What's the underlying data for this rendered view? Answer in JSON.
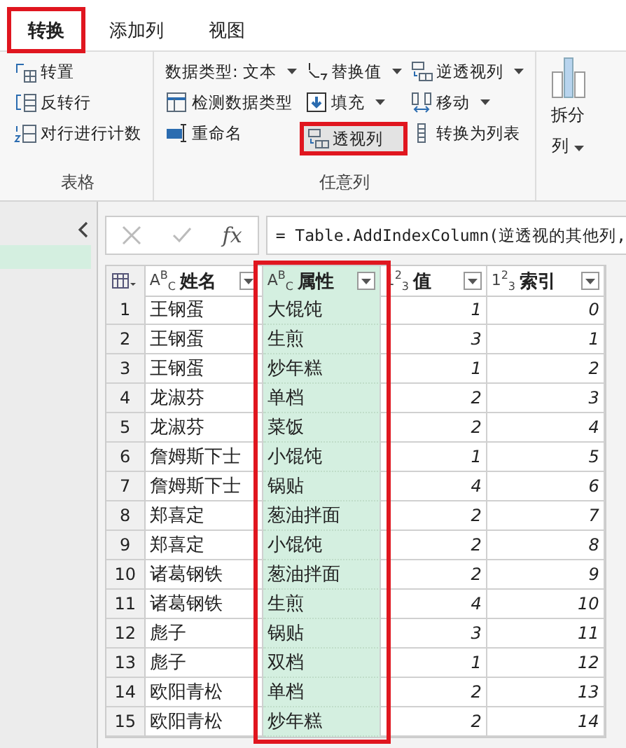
{
  "tabs": [
    {
      "label": "转换",
      "selected": true,
      "highlighted": true
    },
    {
      "label": "添加列",
      "selected": false,
      "highlighted": false
    },
    {
      "label": "视图",
      "selected": false,
      "highlighted": false
    }
  ],
  "ribbon": {
    "groups": [
      {
        "label": "表格",
        "columns": [
          [
            {
              "label": "转置",
              "kind": "transpose",
              "dropdown": false,
              "highlighted": false
            },
            {
              "label": "反转行",
              "kind": "reverse",
              "dropdown": false,
              "highlighted": false
            },
            {
              "label": "对行进行计数",
              "kind": "count",
              "dropdown": false,
              "highlighted": false
            }
          ]
        ]
      },
      {
        "label": "任意列",
        "columns": [
          [
            {
              "label": "数据类型: 文本",
              "kind": "type",
              "dropdown": true,
              "highlighted": false
            },
            {
              "label": "检测数据类型",
              "kind": "detect",
              "dropdown": false,
              "highlighted": false
            },
            {
              "label": "重命名",
              "kind": "rename",
              "dropdown": false,
              "highlighted": false
            }
          ],
          [
            {
              "label": "替换值",
              "kind": "replace",
              "dropdown": true,
              "highlighted": false
            },
            {
              "label": "填充",
              "kind": "fill",
              "dropdown": true,
              "highlighted": false
            },
            {
              "label": "透视列",
              "kind": "pivot",
              "dropdown": false,
              "highlighted": true
            }
          ],
          [
            {
              "label": "逆透视列",
              "kind": "unpivot",
              "dropdown": true,
              "highlighted": false
            },
            {
              "label": "移动",
              "kind": "move",
              "dropdown": true,
              "highlighted": false
            },
            {
              "label": "转换为列表",
              "kind": "list",
              "dropdown": false,
              "highlighted": false
            }
          ]
        ]
      }
    ],
    "big_button": {
      "label_1": "拆分",
      "label_2": "列",
      "dropdown": true
    }
  },
  "formula_bar": {
    "fx": "fx",
    "formula": "= Table.AddIndexColumn(逆透视的其他列,"
  },
  "table": {
    "columns": [
      {
        "name": "姓名",
        "type": "A$^{B}$$_{C}$",
        "kind": "text",
        "selected": false,
        "highlighted": false
      },
      {
        "name": "属性",
        "type": "A$^{B}$$_{C}$",
        "kind": "text",
        "selected": true,
        "highlighted": true
      },
      {
        "name": "值",
        "type": "1$^{2}$$_{3}$",
        "kind": "number",
        "selected": false,
        "highlighted": false
      },
      {
        "name": "索引",
        "type": "1$^{2}$$_{3}$",
        "kind": "number",
        "selected": false,
        "highlighted": false
      }
    ],
    "rows": [
      {
        "n": "1",
        "cells": [
          "王钢蛋",
          "大馄饨",
          "1",
          "0"
        ]
      },
      {
        "n": "2",
        "cells": [
          "王钢蛋",
          "生煎",
          "3",
          "1"
        ]
      },
      {
        "n": "3",
        "cells": [
          "王钢蛋",
          "炒年糕",
          "1",
          "2"
        ]
      },
      {
        "n": "4",
        "cells": [
          "龙淑芬",
          "单档",
          "2",
          "3"
        ]
      },
      {
        "n": "5",
        "cells": [
          "龙淑芬",
          "菜饭",
          "2",
          "4"
        ]
      },
      {
        "n": "6",
        "cells": [
          "詹姆斯下士",
          "小馄饨",
          "1",
          "5"
        ]
      },
      {
        "n": "7",
        "cells": [
          "詹姆斯下士",
          "锅贴",
          "4",
          "6"
        ]
      },
      {
        "n": "8",
        "cells": [
          "郑喜定",
          "葱油拌面",
          "2",
          "7"
        ]
      },
      {
        "n": "9",
        "cells": [
          "郑喜定",
          "小馄饨",
          "2",
          "8"
        ]
      },
      {
        "n": "10",
        "cells": [
          "诸葛钢铁",
          "葱油拌面",
          "2",
          "9"
        ]
      },
      {
        "n": "11",
        "cells": [
          "诸葛钢铁",
          "生煎",
          "4",
          "10"
        ]
      },
      {
        "n": "12",
        "cells": [
          "彪子",
          "锅贴",
          "3",
          "11"
        ]
      },
      {
        "n": "13",
        "cells": [
          "彪子",
          "双档",
          "1",
          "12"
        ]
      },
      {
        "n": "14",
        "cells": [
          "欧阳青松",
          "单档",
          "2",
          "13"
        ]
      },
      {
        "n": "15",
        "cells": [
          "欧阳青松",
          "炒年糕",
          "2",
          "14"
        ]
      }
    ]
  }
}
